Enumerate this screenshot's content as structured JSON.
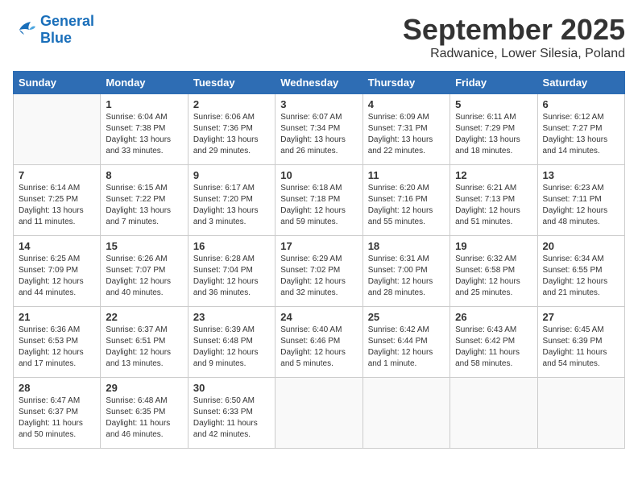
{
  "logo": {
    "line1": "General",
    "line2": "Blue"
  },
  "title": "September 2025",
  "subtitle": "Radwanice, Lower Silesia, Poland",
  "weekdays": [
    "Sunday",
    "Monday",
    "Tuesday",
    "Wednesday",
    "Thursday",
    "Friday",
    "Saturday"
  ],
  "weeks": [
    [
      {
        "day": "",
        "info": ""
      },
      {
        "day": "1",
        "info": "Sunrise: 6:04 AM\nSunset: 7:38 PM\nDaylight: 13 hours\nand 33 minutes."
      },
      {
        "day": "2",
        "info": "Sunrise: 6:06 AM\nSunset: 7:36 PM\nDaylight: 13 hours\nand 29 minutes."
      },
      {
        "day": "3",
        "info": "Sunrise: 6:07 AM\nSunset: 7:34 PM\nDaylight: 13 hours\nand 26 minutes."
      },
      {
        "day": "4",
        "info": "Sunrise: 6:09 AM\nSunset: 7:31 PM\nDaylight: 13 hours\nand 22 minutes."
      },
      {
        "day": "5",
        "info": "Sunrise: 6:11 AM\nSunset: 7:29 PM\nDaylight: 13 hours\nand 18 minutes."
      },
      {
        "day": "6",
        "info": "Sunrise: 6:12 AM\nSunset: 7:27 PM\nDaylight: 13 hours\nand 14 minutes."
      }
    ],
    [
      {
        "day": "7",
        "info": "Sunrise: 6:14 AM\nSunset: 7:25 PM\nDaylight: 13 hours\nand 11 minutes."
      },
      {
        "day": "8",
        "info": "Sunrise: 6:15 AM\nSunset: 7:22 PM\nDaylight: 13 hours\nand 7 minutes."
      },
      {
        "day": "9",
        "info": "Sunrise: 6:17 AM\nSunset: 7:20 PM\nDaylight: 13 hours\nand 3 minutes."
      },
      {
        "day": "10",
        "info": "Sunrise: 6:18 AM\nSunset: 7:18 PM\nDaylight: 12 hours\nand 59 minutes."
      },
      {
        "day": "11",
        "info": "Sunrise: 6:20 AM\nSunset: 7:16 PM\nDaylight: 12 hours\nand 55 minutes."
      },
      {
        "day": "12",
        "info": "Sunrise: 6:21 AM\nSunset: 7:13 PM\nDaylight: 12 hours\nand 51 minutes."
      },
      {
        "day": "13",
        "info": "Sunrise: 6:23 AM\nSunset: 7:11 PM\nDaylight: 12 hours\nand 48 minutes."
      }
    ],
    [
      {
        "day": "14",
        "info": "Sunrise: 6:25 AM\nSunset: 7:09 PM\nDaylight: 12 hours\nand 44 minutes."
      },
      {
        "day": "15",
        "info": "Sunrise: 6:26 AM\nSunset: 7:07 PM\nDaylight: 12 hours\nand 40 minutes."
      },
      {
        "day": "16",
        "info": "Sunrise: 6:28 AM\nSunset: 7:04 PM\nDaylight: 12 hours\nand 36 minutes."
      },
      {
        "day": "17",
        "info": "Sunrise: 6:29 AM\nSunset: 7:02 PM\nDaylight: 12 hours\nand 32 minutes."
      },
      {
        "day": "18",
        "info": "Sunrise: 6:31 AM\nSunset: 7:00 PM\nDaylight: 12 hours\nand 28 minutes."
      },
      {
        "day": "19",
        "info": "Sunrise: 6:32 AM\nSunset: 6:58 PM\nDaylight: 12 hours\nand 25 minutes."
      },
      {
        "day": "20",
        "info": "Sunrise: 6:34 AM\nSunset: 6:55 PM\nDaylight: 12 hours\nand 21 minutes."
      }
    ],
    [
      {
        "day": "21",
        "info": "Sunrise: 6:36 AM\nSunset: 6:53 PM\nDaylight: 12 hours\nand 17 minutes."
      },
      {
        "day": "22",
        "info": "Sunrise: 6:37 AM\nSunset: 6:51 PM\nDaylight: 12 hours\nand 13 minutes."
      },
      {
        "day": "23",
        "info": "Sunrise: 6:39 AM\nSunset: 6:48 PM\nDaylight: 12 hours\nand 9 minutes."
      },
      {
        "day": "24",
        "info": "Sunrise: 6:40 AM\nSunset: 6:46 PM\nDaylight: 12 hours\nand 5 minutes."
      },
      {
        "day": "25",
        "info": "Sunrise: 6:42 AM\nSunset: 6:44 PM\nDaylight: 12 hours\nand 1 minute."
      },
      {
        "day": "26",
        "info": "Sunrise: 6:43 AM\nSunset: 6:42 PM\nDaylight: 11 hours\nand 58 minutes."
      },
      {
        "day": "27",
        "info": "Sunrise: 6:45 AM\nSunset: 6:39 PM\nDaylight: 11 hours\nand 54 minutes."
      }
    ],
    [
      {
        "day": "28",
        "info": "Sunrise: 6:47 AM\nSunset: 6:37 PM\nDaylight: 11 hours\nand 50 minutes."
      },
      {
        "day": "29",
        "info": "Sunrise: 6:48 AM\nSunset: 6:35 PM\nDaylight: 11 hours\nand 46 minutes."
      },
      {
        "day": "30",
        "info": "Sunrise: 6:50 AM\nSunset: 6:33 PM\nDaylight: 11 hours\nand 42 minutes."
      },
      {
        "day": "",
        "info": ""
      },
      {
        "day": "",
        "info": ""
      },
      {
        "day": "",
        "info": ""
      },
      {
        "day": "",
        "info": ""
      }
    ]
  ]
}
